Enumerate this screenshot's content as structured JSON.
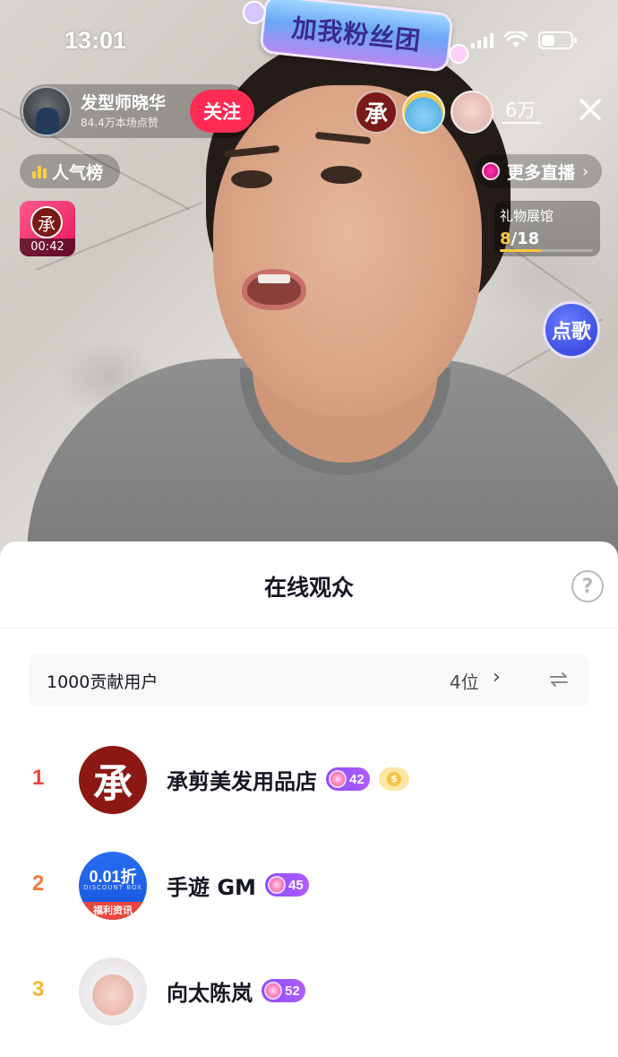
{
  "status_bar": {
    "time": "13:01"
  },
  "fan_club_badge": "加我粉丝团",
  "host": {
    "name": "发型师晓华",
    "likes": "84.4万本场点赞",
    "follow_label": "关注"
  },
  "viewer_count": "6万",
  "popularity_label": "人气榜",
  "more_live_label": "更多直播",
  "gift_card": {
    "logo_char": "承",
    "timer": "00:42"
  },
  "gift_gallery": {
    "label": "礼物展馆",
    "current": "8",
    "total": "/18",
    "progress_fraction": 0.444
  },
  "song_button_label": "点歌",
  "sheet": {
    "title": "在线观众",
    "help_symbol": "?",
    "contributors_label": "1000贡献用户",
    "contributors_count": "4位",
    "chevron": ">"
  },
  "audience": [
    {
      "rank": "1",
      "name": "承剪美发用品店",
      "level": "42",
      "has_coin_badge": true,
      "avatar_text": "承",
      "rank_color": "#e8453c"
    },
    {
      "rank": "2",
      "name": "手遊 GM",
      "level": "45",
      "avatar_top": "0.01折",
      "avatar_mid": "DISCOUNT BOX",
      "avatar_bottom": "福利资讯",
      "rank_color": "#f07a3c"
    },
    {
      "rank": "3",
      "name": "向太陈岚",
      "level": "52",
      "rank_color": "#f5b730"
    }
  ],
  "colors": {
    "follow_button": "#fe2c55",
    "level_badge": "#8b4dff",
    "gallery_highlight": "#ffc83a"
  }
}
